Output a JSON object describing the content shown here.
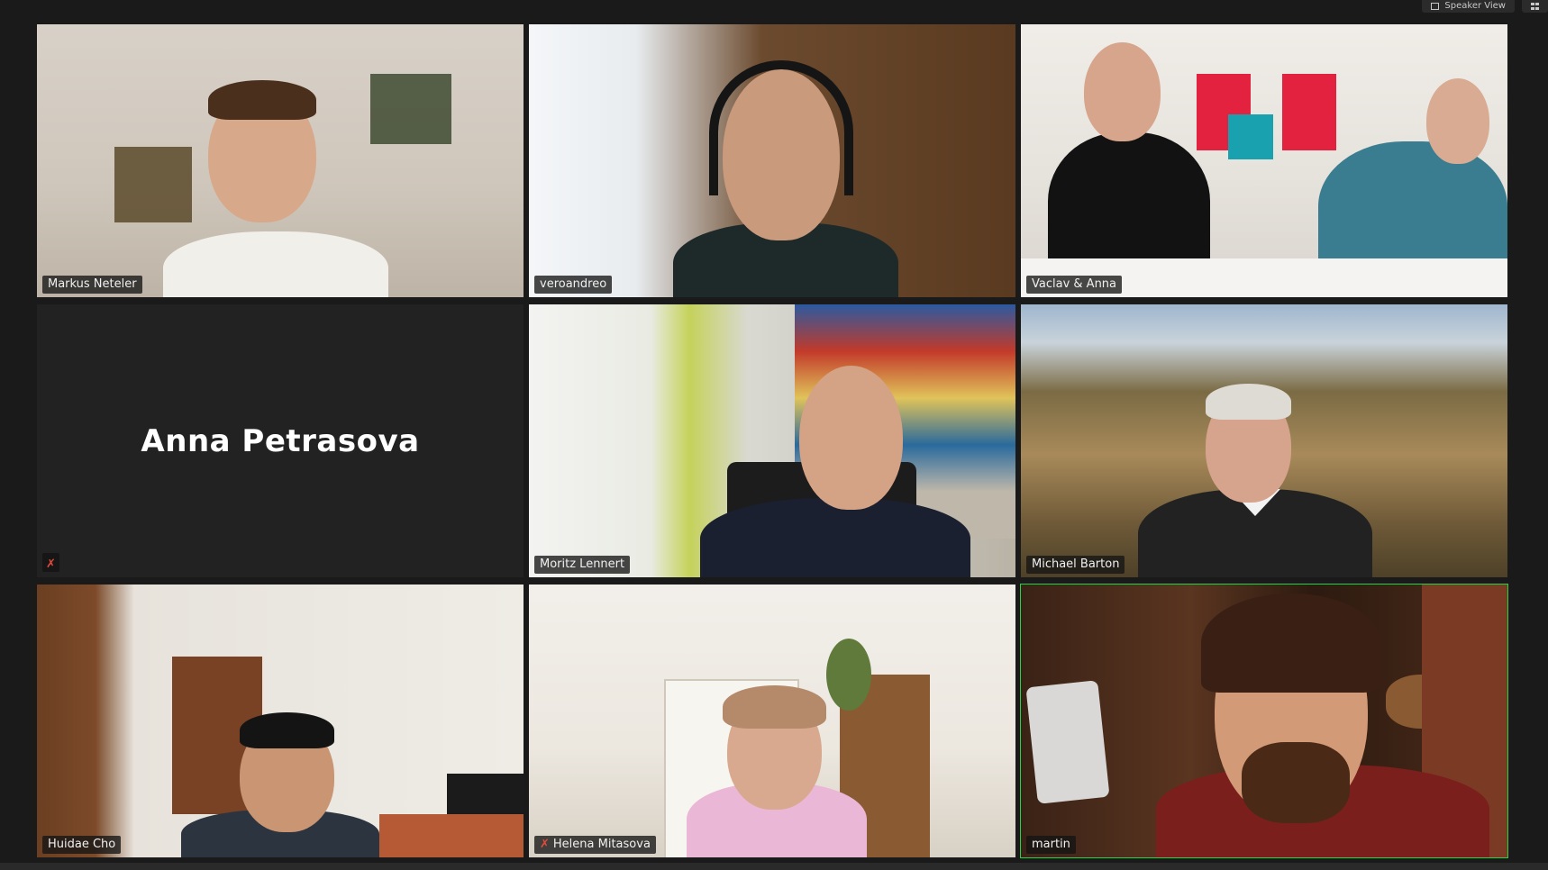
{
  "toolbar": {
    "speaker_view_label": "Speaker View",
    "gallery_label": "Gallery"
  },
  "participants": [
    {
      "name": "Markus Neteler",
      "muted": false,
      "video": true,
      "active_speaker": false
    },
    {
      "name": "veroandreo",
      "muted": false,
      "video": true,
      "active_speaker": false
    },
    {
      "name": "Vaclav & Anna",
      "muted": false,
      "video": true,
      "active_speaker": false
    },
    {
      "name": "Anna Petrasova",
      "muted": true,
      "video": false,
      "active_speaker": false
    },
    {
      "name": "Moritz Lennert",
      "muted": false,
      "video": true,
      "active_speaker": false
    },
    {
      "name": "Michael Barton",
      "muted": false,
      "video": true,
      "active_speaker": false
    },
    {
      "name": "Huidae Cho",
      "muted": false,
      "video": true,
      "active_speaker": false
    },
    {
      "name": "Helena Mitasova",
      "muted": true,
      "video": true,
      "active_speaker": false
    },
    {
      "name": "martin",
      "muted": false,
      "video": true,
      "active_speaker": true
    }
  ],
  "colors": {
    "active_speaker_border": "#27d24a",
    "muted_icon": "#e24b3b",
    "background": "#1a1a1a"
  },
  "icons": {
    "muted": "microphone-muted-icon",
    "speaker_view": "speaker-view-icon",
    "gallery": "gallery-view-icon"
  }
}
